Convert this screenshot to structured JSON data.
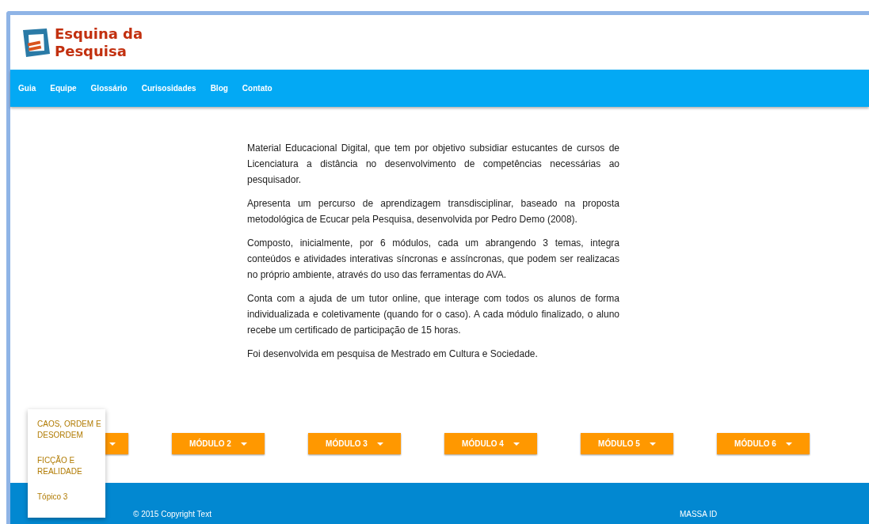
{
  "logo": {
    "line_1": "Esquina da",
    "line_2": "Pesquisa"
  },
  "nav": [
    {
      "label": "Guia"
    },
    {
      "label": "Equipe"
    },
    {
      "label": "Glossário"
    },
    {
      "label": "Curisosidades"
    },
    {
      "label": "Blog"
    },
    {
      "label": "Contato"
    }
  ],
  "paragraphs": [
    "Material Educacional Digital, que tem por objetivo subsidiar estucantes de cursos de Licenciatura a distância no desenvolvimento de competências necessárias ao pesquisador.",
    "Apresenta um percurso de aprendizagem transdisciplinar, baseado na proposta metodológica de Ecucar pela Pesquisa, desenvolvida por Pedro Demo (2008).",
    "Composto, inicialmente, por 6 módulos, cada um abrangendo 3 temas, integra conteúdos e atividades interativas síncronas e assíncronas, que podem ser realizacas no próprio ambiente, através do uso das ferramentas do AVA.",
    "Conta com a ajuda de um tutor online, que interage com todos os alunos de forma individualizada e coletivamente (quando for o caso). A cada módulo finalizado, o aluno recebe um certificado de participação de 15 horas.",
    "Foi desenvolvida em pesquisa de Mestrado em Cultura e Sociedade."
  ],
  "modules": [
    {
      "expanded": true,
      "menu": [
        "CAOS, ORDEM E DESORDEM",
        "FICÇÃO E REALIDADE",
        "Tópico 3"
      ]
    },
    {
      "label": "MÓDULO 2",
      "expanded": false
    },
    {
      "label": "MÓDULO 3",
      "expanded": false
    },
    {
      "label": "MÓDULO 4",
      "expanded": false
    },
    {
      "label": "MÓDULO 5",
      "expanded": false
    },
    {
      "label": "MÓDULO 6",
      "expanded": false
    }
  ],
  "footer": {
    "copyright": "© 2015 Copyright Text",
    "credit": "MASSA ID"
  }
}
